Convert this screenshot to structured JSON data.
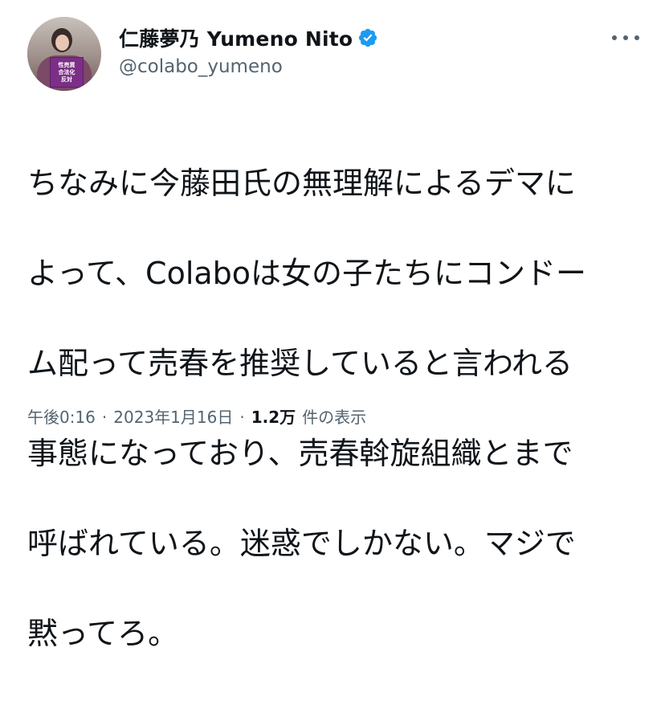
{
  "author": {
    "display_name": "仁藤夢乃 Yumeno Nito",
    "handle": "@colabo_yumeno",
    "verified": true,
    "avatar_sign_text": [
      "性売買",
      "合法化",
      "反対"
    ]
  },
  "tweet": {
    "text_lines": [
      "ちなみに今藤田氏の無理解によるデマに",
      "よって、Colaboは女の子たちにコンドー",
      "ム配って売春を推奨していると言われる",
      "事態になっており、売春斡旋組織とまで",
      "呼ばれている。迷惑でしかない。マジで",
      "黙ってろ。"
    ]
  },
  "meta": {
    "time": "午後0:16",
    "separator": "·",
    "date": "2023年1月16日",
    "views_count": "1.2万",
    "views_label": "件の表示"
  },
  "colors": {
    "text": "#0f1419",
    "secondary": "#536471",
    "verified_badge": "#1d9bf0"
  },
  "icons": {
    "verified": "verified-badge-icon",
    "more": "more-options-icon"
  }
}
